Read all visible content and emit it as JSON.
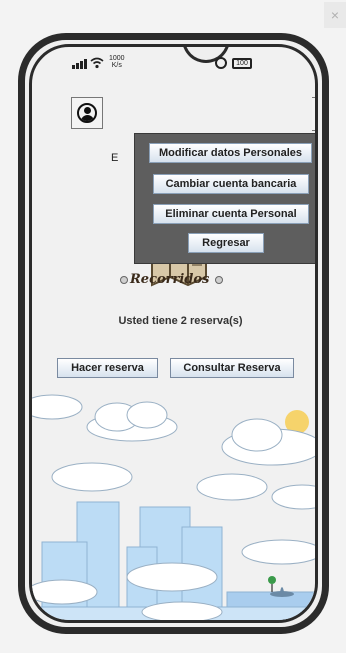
{
  "window": {
    "close_label": "×"
  },
  "status_bar": {
    "speed_value": "1000",
    "speed_unit": "K/s",
    "battery": "100"
  },
  "header": {
    "partial_text": "E"
  },
  "logo": {
    "text": "Recorridos"
  },
  "main": {
    "reservation_message": "Usted tiene 2 reserva(s)",
    "buttons": {
      "make_reservation": "Hacer reserva",
      "check_reservation": "Consultar Reserva"
    }
  },
  "popup_menu": {
    "items": [
      {
        "label": "Modificar datos Personales"
      },
      {
        "label": "Cambiar cuenta bancaria"
      },
      {
        "label": "Eliminar cuenta Personal"
      },
      {
        "label": "Regresar"
      }
    ]
  },
  "colors": {
    "phone_frame": "#2b2b2b",
    "popup_bg": "#5e5e5e",
    "sky_cloud": "#ffffff",
    "building": "#b9d9f3",
    "sun": "#f6d36b"
  }
}
